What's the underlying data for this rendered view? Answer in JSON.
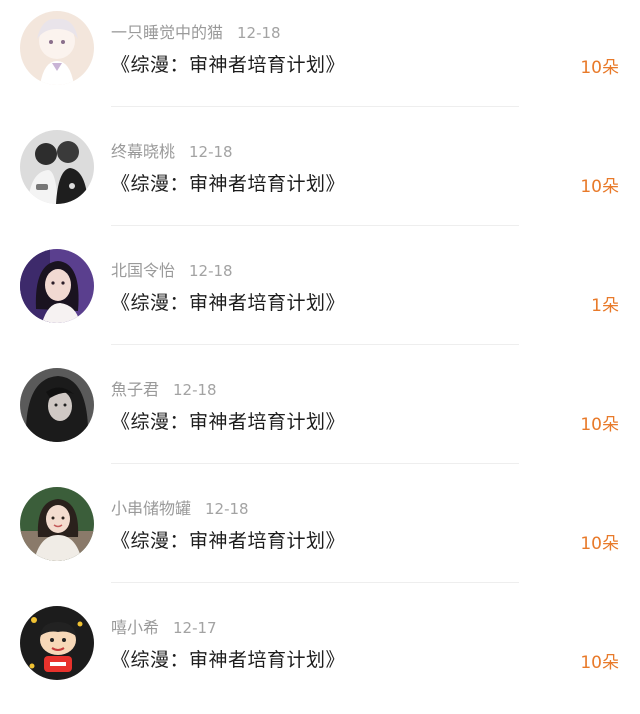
{
  "colors": {
    "gift_count": "#e87a2a",
    "username": "#9a9a9a",
    "title": "#1d1d1d"
  },
  "items": [
    {
      "user": "一只睡觉中的猫",
      "date": "12-18",
      "work": "《综漫：审神者培育计划》",
      "count": "10朵",
      "avatar": "anime-character-avatar"
    },
    {
      "user": "终幕晓桃",
      "date": "12-18",
      "work": "《综漫：审神者培育计划》",
      "count": "10朵",
      "avatar": "couple-photo-avatar"
    },
    {
      "user": "北国令怡",
      "date": "12-18",
      "work": "《综漫：审神者培育计划》",
      "count": "1朵",
      "avatar": "girl-portrait-avatar"
    },
    {
      "user": "魚子君",
      "date": "12-18",
      "work": "《综漫：审神者培育计划》",
      "count": "10朵",
      "avatar": "girl-dark-hair-avatar"
    },
    {
      "user": "小串储物罐",
      "date": "12-18",
      "work": "《综漫：审神者培育计划》",
      "count": "10朵",
      "avatar": "girl-photo-avatar"
    },
    {
      "user": "嘻小希",
      "date": "12-17",
      "work": "《综漫：审神者培育计划》",
      "count": "10朵",
      "avatar": "cartoon-character-avatar"
    }
  ]
}
